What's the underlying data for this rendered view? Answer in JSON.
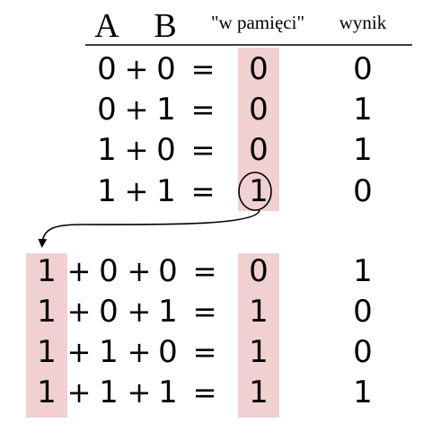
{
  "headers": {
    "a": "A",
    "b": "B",
    "memory": "\"w pamięci\"",
    "result": "wynik"
  },
  "colors": {
    "highlight": "#f0d0d0",
    "line": "#000000"
  },
  "table_top": {
    "plus": "+",
    "equals": "=",
    "rows": [
      {
        "a": "0",
        "b": "0",
        "memory": "0",
        "result": "0"
      },
      {
        "a": "0",
        "b": "1",
        "memory": "0",
        "result": "1"
      },
      {
        "a": "1",
        "b": "0",
        "memory": "0",
        "result": "1"
      },
      {
        "a": "1",
        "b": "1",
        "memory": "1",
        "result": "0"
      }
    ]
  },
  "table_bottom": {
    "plus": "+",
    "equals": "=",
    "rows": [
      {
        "carry": "1",
        "a": "0",
        "b": "0",
        "memory": "0",
        "result": "1"
      },
      {
        "carry": "1",
        "a": "0",
        "b": "1",
        "memory": "1",
        "result": "0"
      },
      {
        "carry": "1",
        "a": "1",
        "b": "0",
        "memory": "1",
        "result": "0"
      },
      {
        "carry": "1",
        "a": "1",
        "b": "1",
        "memory": "1",
        "result": "1"
      }
    ]
  }
}
